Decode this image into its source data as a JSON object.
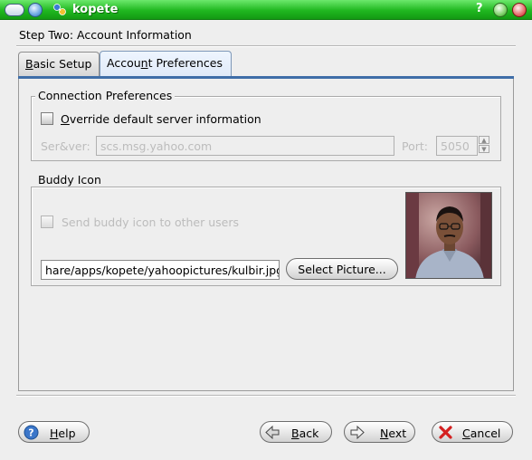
{
  "window": {
    "title": "kopete",
    "help_glyph": "?"
  },
  "wizard": {
    "step_title": "Step Two: Account Information"
  },
  "tabs": [
    {
      "label": "Basic Setup",
      "accel": "B",
      "rest": "asic Setup"
    },
    {
      "label": "Account Preferences",
      "pre": "Accou",
      "accel": "n",
      "rest": "t Preferences"
    }
  ],
  "connection": {
    "group_title": "Connection Preferences",
    "override_pre": "",
    "override_accel": "O",
    "override_rest": "verride default server information",
    "server_label": "Ser&ver:",
    "server_value": "scs.msg.yahoo.com",
    "port_label": "Port:",
    "port_value": "5050"
  },
  "buddy": {
    "group_title": "Buddy Icon",
    "send_label": "Send buddy icon to other users",
    "path_value": "hare/apps/kopete/yahoopictures/kulbir.jpg",
    "select_button": "Select Picture..."
  },
  "footer": {
    "help": {
      "accel": "H",
      "rest": "elp"
    },
    "back": {
      "accel": "B",
      "rest": "ack"
    },
    "next": {
      "accel": "N",
      "rest": "ext"
    },
    "cancel": {
      "accel": "C",
      "rest": "ancel"
    }
  },
  "icons": {
    "app": "kopete-icon",
    "help": "help-icon",
    "back": "back-arrow-icon",
    "next": "next-arrow-icon",
    "cancel": "cancel-x-icon"
  }
}
